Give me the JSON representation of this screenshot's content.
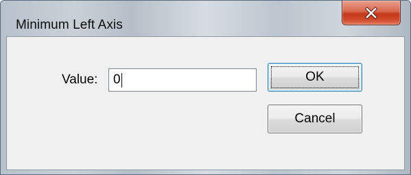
{
  "window": {
    "title": "Minimum Left Axis"
  },
  "titlebar": {
    "close_icon": "close-x-icon"
  },
  "form": {
    "value_label": "Value:",
    "value_input": "0"
  },
  "buttons": {
    "ok_label": "OK",
    "cancel_label": "Cancel"
  },
  "colors": {
    "close_button": "#c4371b",
    "client_background": "#f0f0f0",
    "default_button_border": "#3c7fb1"
  }
}
